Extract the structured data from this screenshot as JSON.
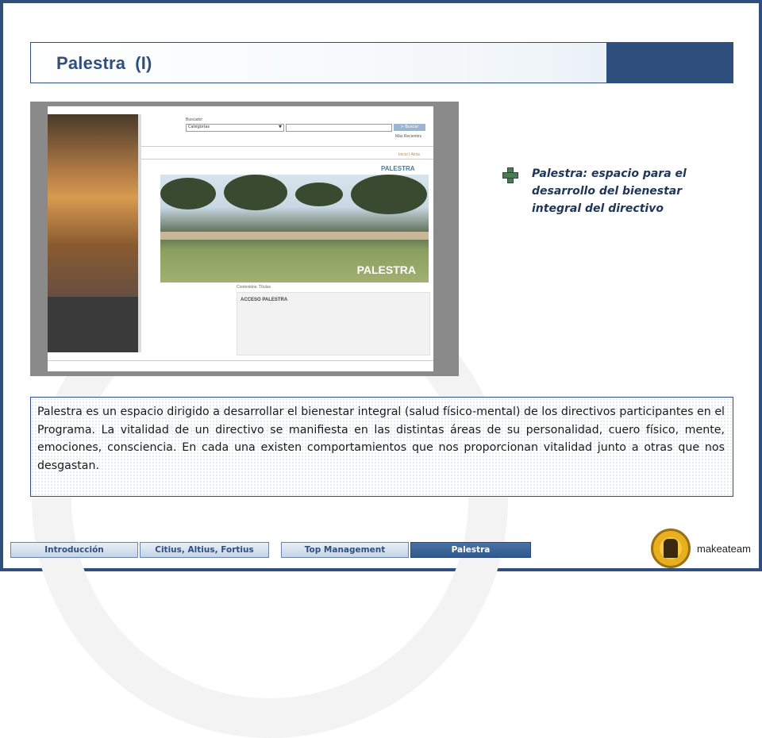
{
  "header": {
    "title": "Palestra",
    "subtitle": "(I)",
    "accent_color": "#2f4f7f"
  },
  "screenshot": {
    "search_label": "Buscador",
    "category_select": "Categorías",
    "search_button": "> Buscar",
    "recent_link": "Más Recientes",
    "nav_links": "Inicio | Atrás",
    "section_heading": "PALESTRA",
    "banner_text": "PALESTRA",
    "contents_link": "Contenidos: Títulos",
    "access_box_title": "ACCESO PALESTRA"
  },
  "callout": {
    "icon": "plus-icon",
    "text": "Palestra: espacio para el desarrollo del bienestar integral del directivo"
  },
  "description": {
    "text": "Palestra es un espacio dirigido a desarrollar el bienestar integral (salud físico-mental) de los directivos participantes en el Programa. La vitalidad de un directivo se manifiesta en las distintas áreas de su personalidad, cuero físico, mente, emociones, consciencia. En cada una existen comportamientos que nos proporcionan vitalidad junto a otras que nos desgastan."
  },
  "nav_tabs": [
    {
      "label": "Introducción",
      "active": false
    },
    {
      "label": "Citius, Altius, Fortius",
      "active": false
    },
    {
      "label": "Top Management",
      "active": false
    },
    {
      "label": "Palestra",
      "active": true
    }
  ],
  "brand": {
    "name": "makeateam"
  }
}
